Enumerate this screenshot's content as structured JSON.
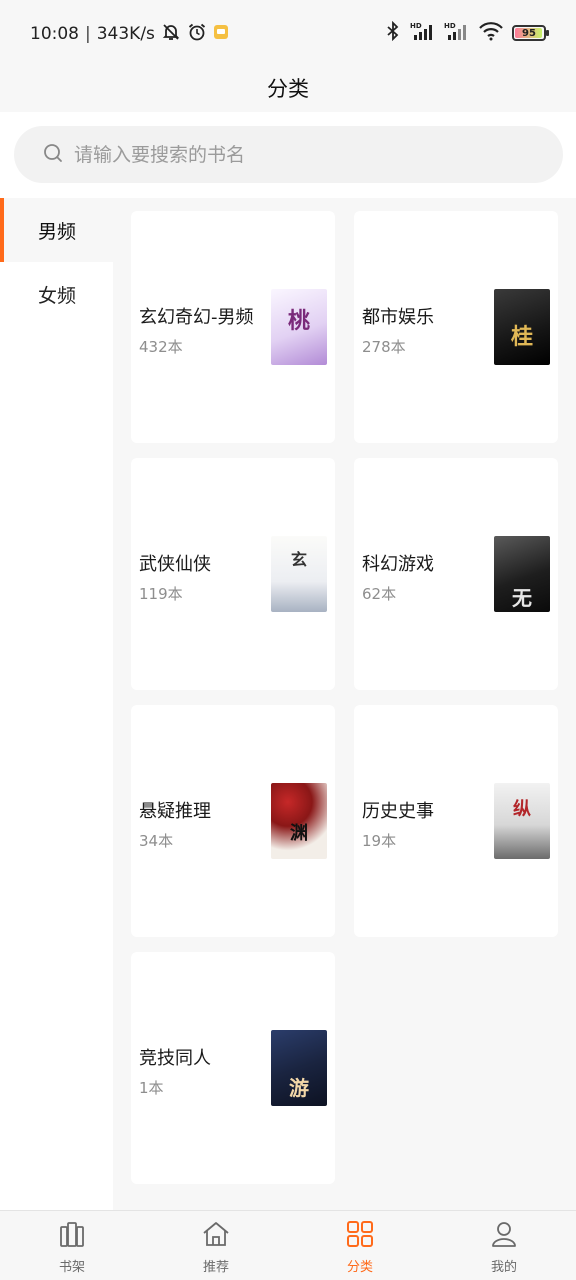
{
  "status": {
    "time": "10:08",
    "speed": "343K/s",
    "battery": "95"
  },
  "header": {
    "title": "分类"
  },
  "search": {
    "placeholder": "请输入要搜索的书名"
  },
  "sidebar": {
    "items": [
      {
        "label": "男频",
        "active": true
      },
      {
        "label": "女频",
        "active": false
      }
    ]
  },
  "categories": [
    {
      "name": "玄幻奇幻-男频",
      "count": "432本",
      "cover_title": "桃",
      "cover_colors": [
        "#f4eefc",
        "#b58fd8"
      ]
    },
    {
      "name": "都市娱乐",
      "count": "278本",
      "cover_title": "桂",
      "cover_colors": [
        "#1b1b1b",
        "#caa24a"
      ]
    },
    {
      "name": "武侠仙侠",
      "count": "119本",
      "cover_title": "玄",
      "cover_colors": [
        "#f3f3f1",
        "#9aa4b5"
      ]
    },
    {
      "name": "科幻游戏",
      "count": "62本",
      "cover_title": "无",
      "cover_colors": [
        "#2a2a2a",
        "#d9d9d9"
      ]
    },
    {
      "name": "悬疑推理",
      "count": "34本",
      "cover_title": "渊",
      "cover_colors": [
        "#f1ece6",
        "#b21f1f"
      ]
    },
    {
      "name": "历史史事",
      "count": "19本",
      "cover_title": "纵",
      "cover_colors": [
        "#e9e9e9",
        "#b3262a"
      ]
    },
    {
      "name": "竞技同人",
      "count": "1本",
      "cover_title": "游",
      "cover_colors": [
        "#1d2a4a",
        "#f2d7a8"
      ]
    }
  ],
  "bottom_nav": [
    {
      "label": "书架",
      "icon": "bookshelf-icon",
      "active": false
    },
    {
      "label": "推荐",
      "icon": "home-icon",
      "active": false
    },
    {
      "label": "分类",
      "icon": "grid-icon",
      "active": true
    },
    {
      "label": "我的",
      "icon": "user-icon",
      "active": false
    }
  ],
  "colors": {
    "accent": "#ff6a1a",
    "background": "#f7f7f7",
    "card": "#ffffff"
  }
}
